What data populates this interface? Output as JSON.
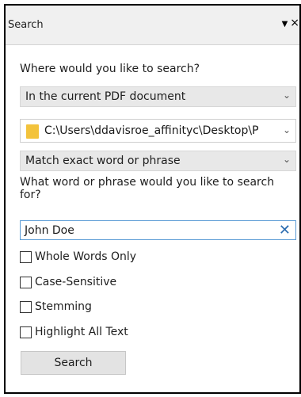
{
  "panel": {
    "title": "Search",
    "dropdown_icon": "▼",
    "close_icon": "×"
  },
  "search_location": {
    "label": "Where would you like to search?",
    "selected": "In the current PDF document"
  },
  "path": {
    "value": "C:\\Users\\ddavisroe_affinityc\\Desktop\\P"
  },
  "match_mode": {
    "selected": "Match exact word or phrase"
  },
  "query": {
    "label": "What word or phrase would you like to search for?",
    "value": "John Doe"
  },
  "options": [
    {
      "label": "Whole Words Only",
      "checked": false
    },
    {
      "label": "Case-Sensitive",
      "checked": false
    },
    {
      "label": "Stemming",
      "checked": false
    },
    {
      "label": "Highlight All Text",
      "checked": false
    }
  ],
  "actions": {
    "search_label": "Search"
  },
  "icons": {
    "chevron": "chevron-down-icon",
    "folder": "folder-icon",
    "clear": "clear-icon"
  },
  "colors": {
    "folder": "#f3c33c",
    "accent": "#2b6cb0"
  }
}
